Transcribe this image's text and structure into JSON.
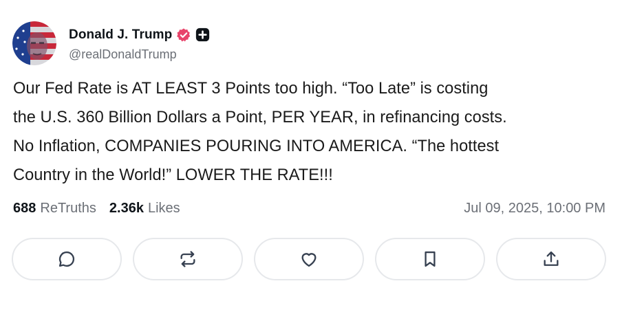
{
  "author": {
    "display_name": "Donald J. Trump",
    "handle": "@realDonaldTrump",
    "verified_badge_color": "#e8446b",
    "plus_badge_color": "#0f1419"
  },
  "post": {
    "text": "Our Fed Rate is AT LEAST 3 Points too high. “Too Late” is costing\nthe U.S. 360 Billion Dollars a Point, PER YEAR, in refinancing costs.\nNo Inflation, COMPANIES POURING INTO AMERICA. “The hottest\nCountry in the World!” LOWER THE RATE!!!",
    "retruths_count": "688",
    "retruths_label": "ReTruths",
    "likes_count": "2.36k",
    "likes_label": "Likes",
    "timestamp": "Jul 09, 2025, 10:00 PM"
  },
  "actions": [
    {
      "icon": "reply-icon"
    },
    {
      "icon": "retruth-icon"
    },
    {
      "icon": "like-icon"
    },
    {
      "icon": "bookmark-icon"
    },
    {
      "icon": "share-icon"
    }
  ],
  "colors": {
    "text": "#0f1419",
    "muted": "#6b6f76",
    "button_border": "#e6e8eb"
  }
}
